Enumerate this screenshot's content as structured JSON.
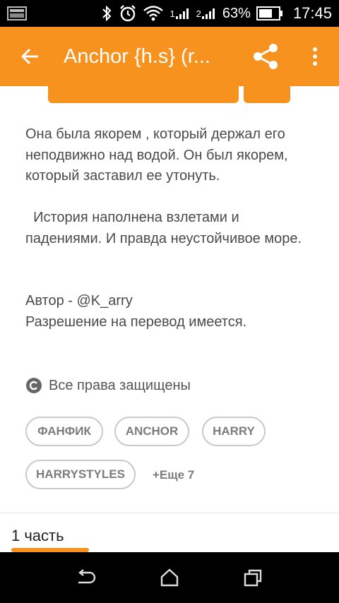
{
  "status_bar": {
    "battery_percent": "63%",
    "time": "17:45",
    "sim1_label": "1",
    "sim2_label": "2",
    "icons": [
      "screenshot-icon",
      "bluetooth-icon",
      "alarm-icon",
      "wifi-icon",
      "signal-icon",
      "battery-icon"
    ]
  },
  "app_bar": {
    "title": "Anchor {h.s} (r...",
    "icons": [
      "back-arrow-icon",
      "share-icon",
      "more-vert-icon"
    ],
    "background": "#f7921e"
  },
  "story": {
    "description": "Она была якорем , который держал его неподвижно над водой. Он был якорем, который заставил ее утонуть.\n\n  История наполнена взлетами и падениями. И правда неустойчивое море.\n\n\nАвтор - @K_arry\nРазрешение на перевод имеется.",
    "copyright_icon": "copyright-icon",
    "copyright": "Все права защищены",
    "tags": [
      "ФАНФИК",
      "ANCHOR",
      "HARRY",
      "HARRYSTYLES"
    ],
    "more_tags": "+Еще 7"
  },
  "parts": {
    "label": "1 часть"
  },
  "nav_bar": {
    "icons": [
      "back-nav-icon",
      "home-icon",
      "recents-icon"
    ]
  }
}
